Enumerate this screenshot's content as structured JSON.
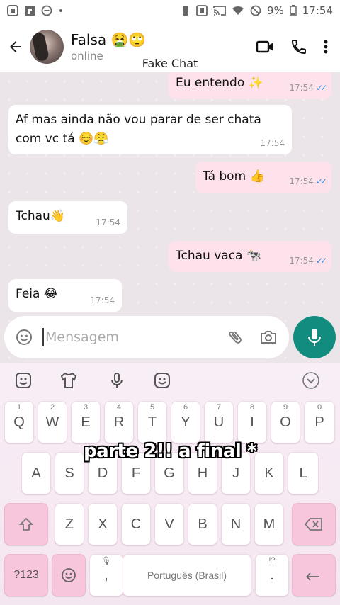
{
  "status_bar": {
    "battery": "9%",
    "time": "17:54"
  },
  "header": {
    "name": "Falsa 🤮🙄",
    "status": "online"
  },
  "watermark": "Fake Chat",
  "messages": [
    {
      "dir": "out",
      "text": "Eu entendo ✨",
      "time": "17:54"
    },
    {
      "dir": "in",
      "text": "Af mas ainda não vou parar de ser chata com vc tá ☺️😤",
      "time": "17:54"
    },
    {
      "dir": "out",
      "text": "Tá bom 👍",
      "time": "17:54"
    },
    {
      "dir": "in",
      "text": "Tchau👋",
      "time": "17:54"
    },
    {
      "dir": "out",
      "text": "Tchau vaca 🐄",
      "time": "17:54"
    },
    {
      "dir": "in",
      "text": "Feia 😂",
      "time": "17:54"
    }
  ],
  "composer": {
    "placeholder": "Mensagem"
  },
  "keyboard": {
    "row1": [
      {
        "k": "Q",
        "n": "1"
      },
      {
        "k": "W",
        "n": "2"
      },
      {
        "k": "E",
        "n": "3"
      },
      {
        "k": "R",
        "n": "4"
      },
      {
        "k": "T",
        "n": "5"
      },
      {
        "k": "Y",
        "n": "6"
      },
      {
        "k": "U",
        "n": "7"
      },
      {
        "k": "I",
        "n": "8"
      },
      {
        "k": "O",
        "n": "9"
      },
      {
        "k": "P",
        "n": "0"
      }
    ],
    "row2": [
      "A",
      "S",
      "D",
      "F",
      "G",
      "H",
      "J",
      "K",
      "L"
    ],
    "row3": [
      "Z",
      "X",
      "C",
      "V",
      "B",
      "N",
      "M"
    ],
    "sym_key": "?123",
    "comma": ",",
    "space": "Português (Brasil)",
    "period": ".",
    "period_hint": "!?"
  },
  "caption": "parte 2!! a final *",
  "colors": {
    "accent": "#128c7e",
    "out_bubble": "#fde2ec",
    "ticks": "#3a8fdc",
    "special_key": "#f7c6dd"
  }
}
